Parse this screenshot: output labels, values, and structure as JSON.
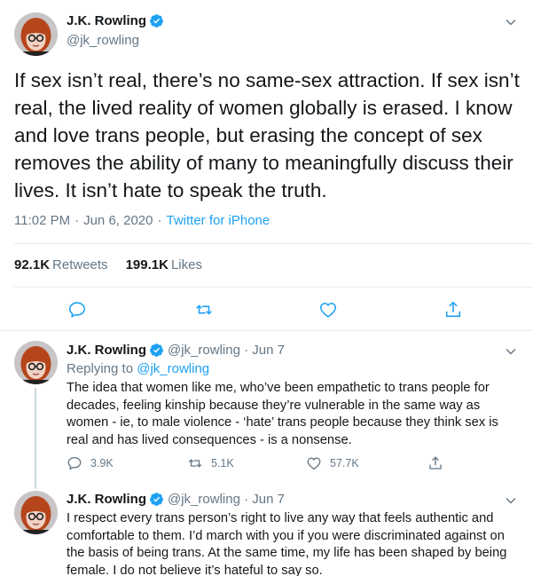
{
  "main": {
    "name": "J.K. Rowling",
    "handle": "@jk_rowling",
    "text": "If sex isn’t real, there’s no same-sex attraction. If sex isn’t real, the lived reality of women globally is erased. I know and love trans people, but erasing the concept of sex removes the ability of many to meaningfully discuss their lives. It isn’t hate to speak the truth.",
    "time": "11:02 PM",
    "date": "Jun 6, 2020",
    "source": "Twitter for iPhone",
    "retweets_count": "92.1K",
    "retweets_label": "Retweets",
    "likes_count": "199.1K",
    "likes_label": "Likes"
  },
  "replies": [
    {
      "name": "J.K. Rowling",
      "handle": "@jk_rowling",
      "date": "Jun 7",
      "replying_prefix": "Replying to",
      "replying_to": "@jk_rowling",
      "text": "The idea that women like me, who’ve been empathetic to trans people for decades, feeling kinship because they’re vulnerable in the same way as women - ie, to male violence - ‘hate’ trans people because they think sex is real and has lived consequences - is a nonsense.",
      "reply_count": "3.9K",
      "retweet_count": "5.1K",
      "like_count": "57.7K"
    },
    {
      "name": "J.K. Rowling",
      "handle": "@jk_rowling",
      "date": "Jun 7",
      "text": "I respect every trans person’s right to live any way that feels authentic and comfortable to them. I’d march with you if you were discriminated against on the basis of being trans. At the same time, my life has been shaped by being female. I do not believe it’s hateful to say so."
    }
  ],
  "colors": {
    "accent": "#1da1f2",
    "secondary_text": "#657786",
    "primary_text": "#14171a",
    "border": "#e6ecf0"
  },
  "icons": [
    "verified-badge-icon",
    "chevron-down-icon",
    "reply-icon",
    "retweet-icon",
    "like-icon",
    "share-icon"
  ]
}
